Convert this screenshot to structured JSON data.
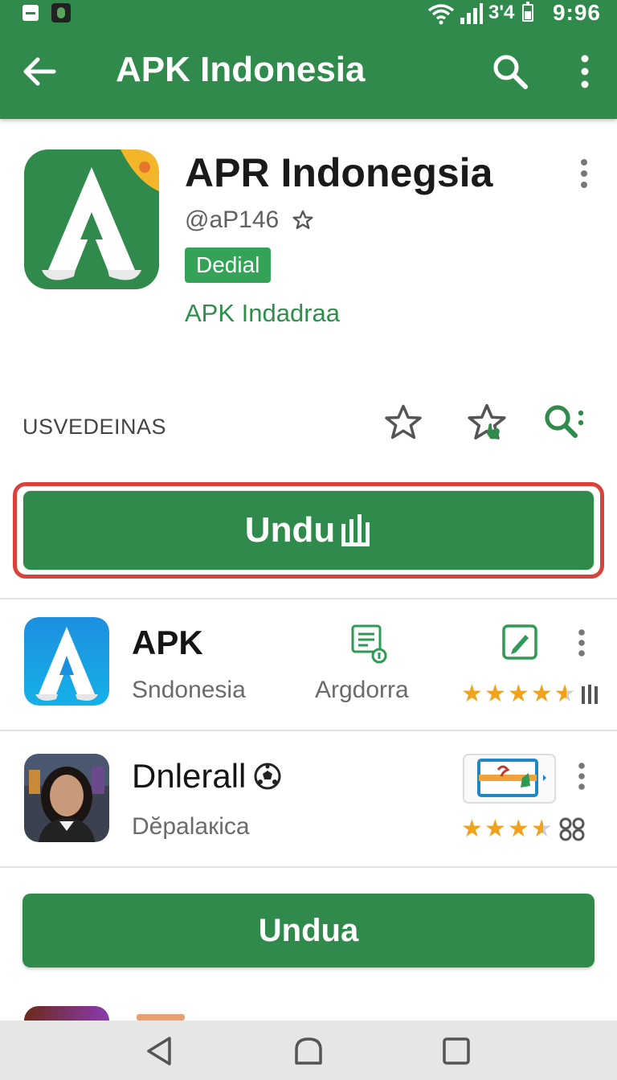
{
  "status_bar": {
    "signal_text": "3'4",
    "time": "9:96",
    "icons": [
      "notification-icon",
      "app-thumbnail-icon",
      "wifi-icon",
      "signal-icon",
      "battery-icon"
    ]
  },
  "app_bar": {
    "title": "APK Indonesia",
    "icons": [
      "back-arrow-icon",
      "search-icon",
      "more-vert-icon"
    ]
  },
  "featured": {
    "name": "APR Indonegsia",
    "handle": "@aP146",
    "badge": "Dedial",
    "developer": "APK Indadraa",
    "section_label": "USVEDEINAS",
    "action_icons": [
      "star-outline-icon",
      "star-hand-icon",
      "search-more-icon"
    ]
  },
  "primary_download": {
    "label": "Undu"
  },
  "list": [
    {
      "title": "APK",
      "subtitle": "Sndonesia",
      "category": "Argdorra",
      "rating": 4.5,
      "icons": [
        "app-a-icon",
        "feedback-icon",
        "edit-icon",
        "bars-icon"
      ]
    },
    {
      "title": "Dnlerall",
      "subtitle": "Dĕpalaкica",
      "rating": 3.5,
      "icons": [
        "portrait-avatar",
        "soccer-ball-icon",
        "app-preview-icon",
        "grid-icon"
      ]
    }
  ],
  "secondary_download": {
    "label": "Undua"
  },
  "nav_bar": {
    "icons": [
      "nav-back-icon",
      "nav-home-icon",
      "nav-recents-icon"
    ]
  },
  "colors": {
    "primary": "#2f8a4b",
    "accent_red": "#d9423a",
    "badge_green": "#34a357",
    "star": "#f0a21a",
    "link_green": "#2f8f4a"
  }
}
